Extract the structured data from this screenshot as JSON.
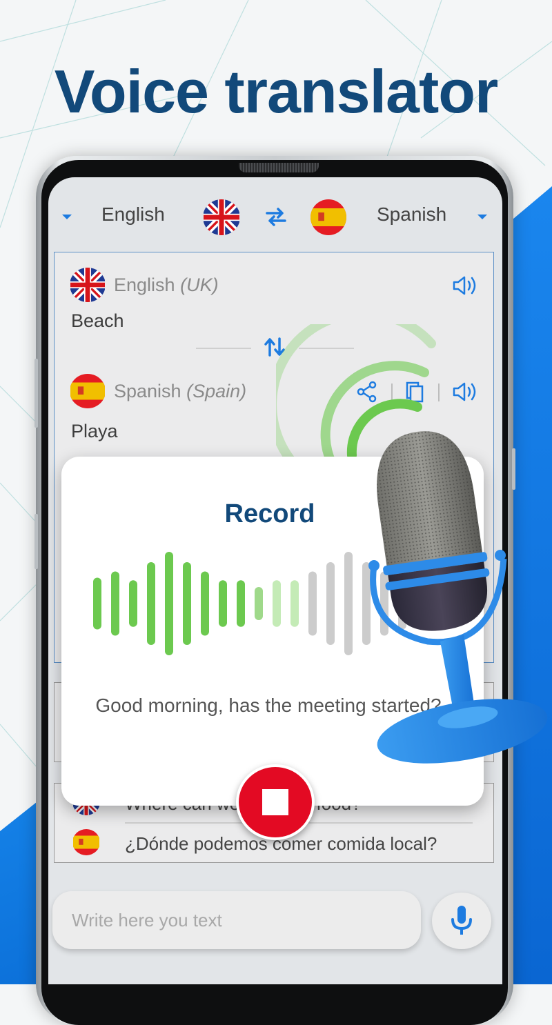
{
  "headline": "Voice translator",
  "language_bar": {
    "source_language": "English",
    "target_language": "Spanish",
    "source_flag": "uk-flag-icon",
    "target_flag": "spain-flag-icon",
    "swap_icon": "swap-horizontal-icon"
  },
  "translation": {
    "source": {
      "language": "English",
      "region": "(UK)",
      "text": "Beach"
    },
    "target": {
      "language": "Spanish",
      "region": "(Spain)",
      "text": "Playa"
    },
    "swap_icon": "swap-vertical-icon",
    "actions": [
      "share-icon",
      "copy-icon",
      "speaker-icon"
    ]
  },
  "history": [
    {
      "source_text": "Where can we eat local food?",
      "target_text": "¿Dónde podemos comer comida local?"
    }
  ],
  "input": {
    "placeholder": "Write here you text",
    "value": ""
  },
  "record_popup": {
    "title": "Record",
    "transcript": "Good morning, has the meeting started?",
    "waveform_levels": [
      0.5,
      0.62,
      0.45,
      0.8,
      1.0,
      0.8,
      0.62,
      0.45,
      0.45,
      0.32,
      0.45,
      0.45,
      0.62,
      0.8,
      1.0,
      0.8,
      0.62,
      0.5,
      0.45
    ],
    "waveform_recorded_count": 10,
    "waveform_fading_count": 3,
    "stop_label": "Stop"
  },
  "colors": {
    "brand_blue": "#12497a",
    "accent_blue": "#1d7be0",
    "recording_green": "#6cc94f",
    "stop_red": "#e30a23"
  }
}
